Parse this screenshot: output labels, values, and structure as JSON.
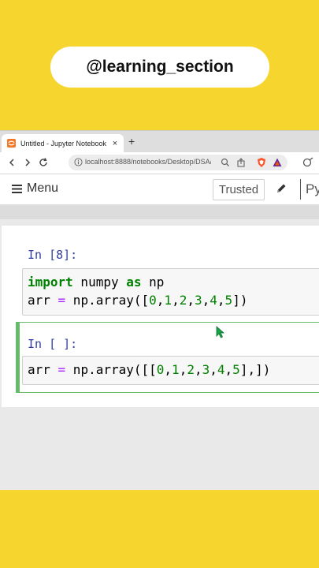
{
  "badge": {
    "text": "@learning_section"
  },
  "browser": {
    "tab_title": "Untitled - Jupyter Notebook",
    "tab_close": "×",
    "new_tab": "+",
    "url": "localhost:8888/notebooks/Desktop/DSA/..."
  },
  "jupyter": {
    "menu_label": "Menu",
    "trusted_label": "Trusted",
    "kernel_label": "Py"
  },
  "cells": [
    {
      "prompt": "In [8]:",
      "code": [
        "import numpy as np",
        "arr = np.array([0,1,2,3,4,5])"
      ]
    },
    {
      "prompt": "In [ ]:",
      "code": [
        "arr = np.array([[0,1,2,3,4,5],])"
      ]
    }
  ],
  "colors": {
    "background": "#f6d52f",
    "prompt": "#303f9f",
    "keyword": "#008000",
    "operator": "#aa22ff",
    "selected_cell": "#66bb6a"
  },
  "icons": [
    "hamburger-icon",
    "pencil-icon",
    "back-arrow-icon",
    "forward-arrow-icon",
    "reload-icon",
    "lock-icon",
    "zoom-icon",
    "share-icon",
    "brave-shield-icon",
    "brave-rewards-icon",
    "extension-icon",
    "mouse-cursor-icon"
  ]
}
